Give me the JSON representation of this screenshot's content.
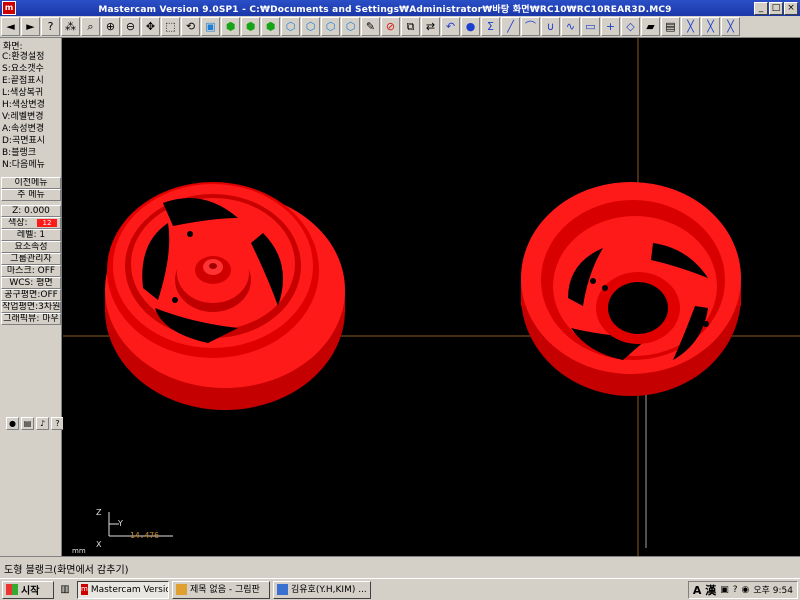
{
  "window": {
    "app_icon": "mastercam-app-icon",
    "title": "Mastercam Version 9.0SP1 - C:₩Documents and Settings₩Administrator₩바탕 화면₩RC10₩RC10REAR3D.MC9",
    "minimize": "_",
    "maximize": "□",
    "close": "×"
  },
  "toolbar": {
    "icons": [
      "left-arrow-icon",
      "right-arrow-icon",
      "help-icon",
      "analyze-icon",
      "zoom-window-icon",
      "zoom-in-icon",
      "zoom-out-icon",
      "pan-icon",
      "select-icon",
      "rotate-icon",
      "view-top-icon",
      "view-front-icon",
      "view-side-icon",
      "view-iso-icon",
      "view-cube-1-icon",
      "view-cube-2-icon",
      "view-cube-3-icon",
      "view-cube-4-icon",
      "pencil-icon",
      "delete-icon",
      "transform-icon",
      "xform-icon",
      "undo-icon",
      "sphere-icon",
      "sigma-icon",
      "line-icon",
      "arc-icon",
      "curve-icon",
      "spline-icon",
      "rectangle-icon",
      "point-icon",
      "surface-icon",
      "solid-icon",
      "lathe-icon",
      "misc-1-icon",
      "misc-2-icon",
      "misc-3-icon"
    ]
  },
  "menu": {
    "title": "화면:",
    "items": [
      "C:환경설정",
      "S:요소갯수",
      "E:끝점표시",
      "L:색상복귀",
      "H:색상변경",
      "V:레벨변경",
      "A:속성변경",
      "D:곡면표시",
      "B:블랭크",
      "N:다음메뉴"
    ],
    "prev_menu": "이전메뉴",
    "main_menu": "주 메뉴"
  },
  "status_panel": {
    "z": "Z:  0.000",
    "color_label": "색상:",
    "color_value": "12",
    "level": "레벨: 1",
    "attributes": "요소속성",
    "group": "그룹관리자",
    "mask": "마스크: OFF",
    "wcs": "WCS: 평면",
    "tool_plane": "공구평면:OFF",
    "construct_plane": "작업평면:3차원",
    "graphics_view": "그래픽뷰: 마우"
  },
  "mini_toolbar": [
    "record-icon",
    "save-icon",
    "sound-icon",
    "help-icon",
    "close-icon"
  ],
  "viewport": {
    "axis_z": "Z",
    "axis_y": "Y",
    "axis_x": "X",
    "scale": "14.476",
    "units": "mm",
    "geometry_color": "#ff1a1a",
    "axis_line_color": "#8a5a20"
  },
  "prompt": {
    "text": "도형 블랭크(화면에서 감추기)"
  },
  "taskbar": {
    "start": "시작",
    "tasks": [
      {
        "label": "Mastercam Versio...",
        "active": true
      },
      {
        "label": "제목 없음 - 그림판",
        "active": false
      },
      {
        "label": "김유호(Y.H,KIM) ...",
        "active": false
      }
    ],
    "ime": "A 漢",
    "clock": "오후 9:54"
  }
}
